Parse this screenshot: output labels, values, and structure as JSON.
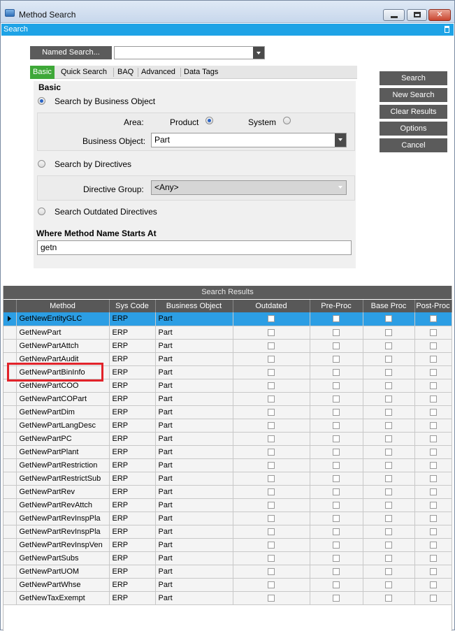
{
  "window": {
    "title": "Method Search"
  },
  "panel": {
    "header": "Search"
  },
  "named_search": {
    "label": "Named Search...",
    "value": ""
  },
  "tabs": [
    {
      "label": "Basic",
      "active": true
    },
    {
      "label": "Quick Search"
    },
    {
      "label": "BAQ"
    },
    {
      "label": "Advanced"
    },
    {
      "label": "Data Tags"
    }
  ],
  "basic": {
    "title": "Basic",
    "search_by_bo": "Search by Business Object",
    "area_label": "Area:",
    "area_product": "Product",
    "area_system": "System",
    "bo_label": "Business Object:",
    "bo_value": "Part",
    "search_by_directives": "Search by Directives",
    "directive_group_label": "Directive Group:",
    "directive_group_value": "<Any>",
    "search_outdated": "Search Outdated Directives"
  },
  "where": {
    "title": "Where Method Name Starts At",
    "value": "getn"
  },
  "buttons": {
    "search": "Search",
    "new_search": "New Search",
    "clear_results": "Clear Results",
    "options": "Options",
    "cancel": "Cancel"
  },
  "results": {
    "title": "Search Results",
    "columns": [
      "Method",
      "Sys Code",
      "Business Object",
      "Outdated",
      "Pre-Proc",
      "Base Proc",
      "Post-Proc"
    ],
    "rows": [
      {
        "method": "GetNewEntityGLC",
        "sys": "ERP",
        "bo": "Part"
      },
      {
        "method": "GetNewPart",
        "sys": "ERP",
        "bo": "Part"
      },
      {
        "method": "GetNewPartAttch",
        "sys": "ERP",
        "bo": "Part"
      },
      {
        "method": "GetNewPartAudit",
        "sys": "ERP",
        "bo": "Part"
      },
      {
        "method": "GetNewPartBinInfo",
        "sys": "ERP",
        "bo": "Part"
      },
      {
        "method": "GetNewPartCOO",
        "sys": "ERP",
        "bo": "Part"
      },
      {
        "method": "GetNewPartCOPart",
        "sys": "ERP",
        "bo": "Part"
      },
      {
        "method": "GetNewPartDim",
        "sys": "ERP",
        "bo": "Part"
      },
      {
        "method": "GetNewPartLangDesc",
        "sys": "ERP",
        "bo": "Part"
      },
      {
        "method": "GetNewPartPC",
        "sys": "ERP",
        "bo": "Part"
      },
      {
        "method": "GetNewPartPlant",
        "sys": "ERP",
        "bo": "Part"
      },
      {
        "method": "GetNewPartRestriction",
        "sys": "ERP",
        "bo": "Part"
      },
      {
        "method": "GetNewPartRestrictSub",
        "sys": "ERP",
        "bo": "Part"
      },
      {
        "method": "GetNewPartRev",
        "sys": "ERP",
        "bo": "Part"
      },
      {
        "method": "GetNewPartRevAttch",
        "sys": "ERP",
        "bo": "Part"
      },
      {
        "method": "GetNewPartRevInspPla",
        "sys": "ERP",
        "bo": "Part"
      },
      {
        "method": "GetNewPartRevInspPla",
        "sys": "ERP",
        "bo": "Part"
      },
      {
        "method": "GetNewPartRevInspVen",
        "sys": "ERP",
        "bo": "Part"
      },
      {
        "method": "GetNewPartSubs",
        "sys": "ERP",
        "bo": "Part"
      },
      {
        "method": "GetNewPartUOM",
        "sys": "ERP",
        "bo": "Part"
      },
      {
        "method": "GetNewPartWhse",
        "sys": "ERP",
        "bo": "Part"
      },
      {
        "method": "GetNewTaxExempt",
        "sys": "ERP",
        "bo": "Part"
      }
    ]
  }
}
